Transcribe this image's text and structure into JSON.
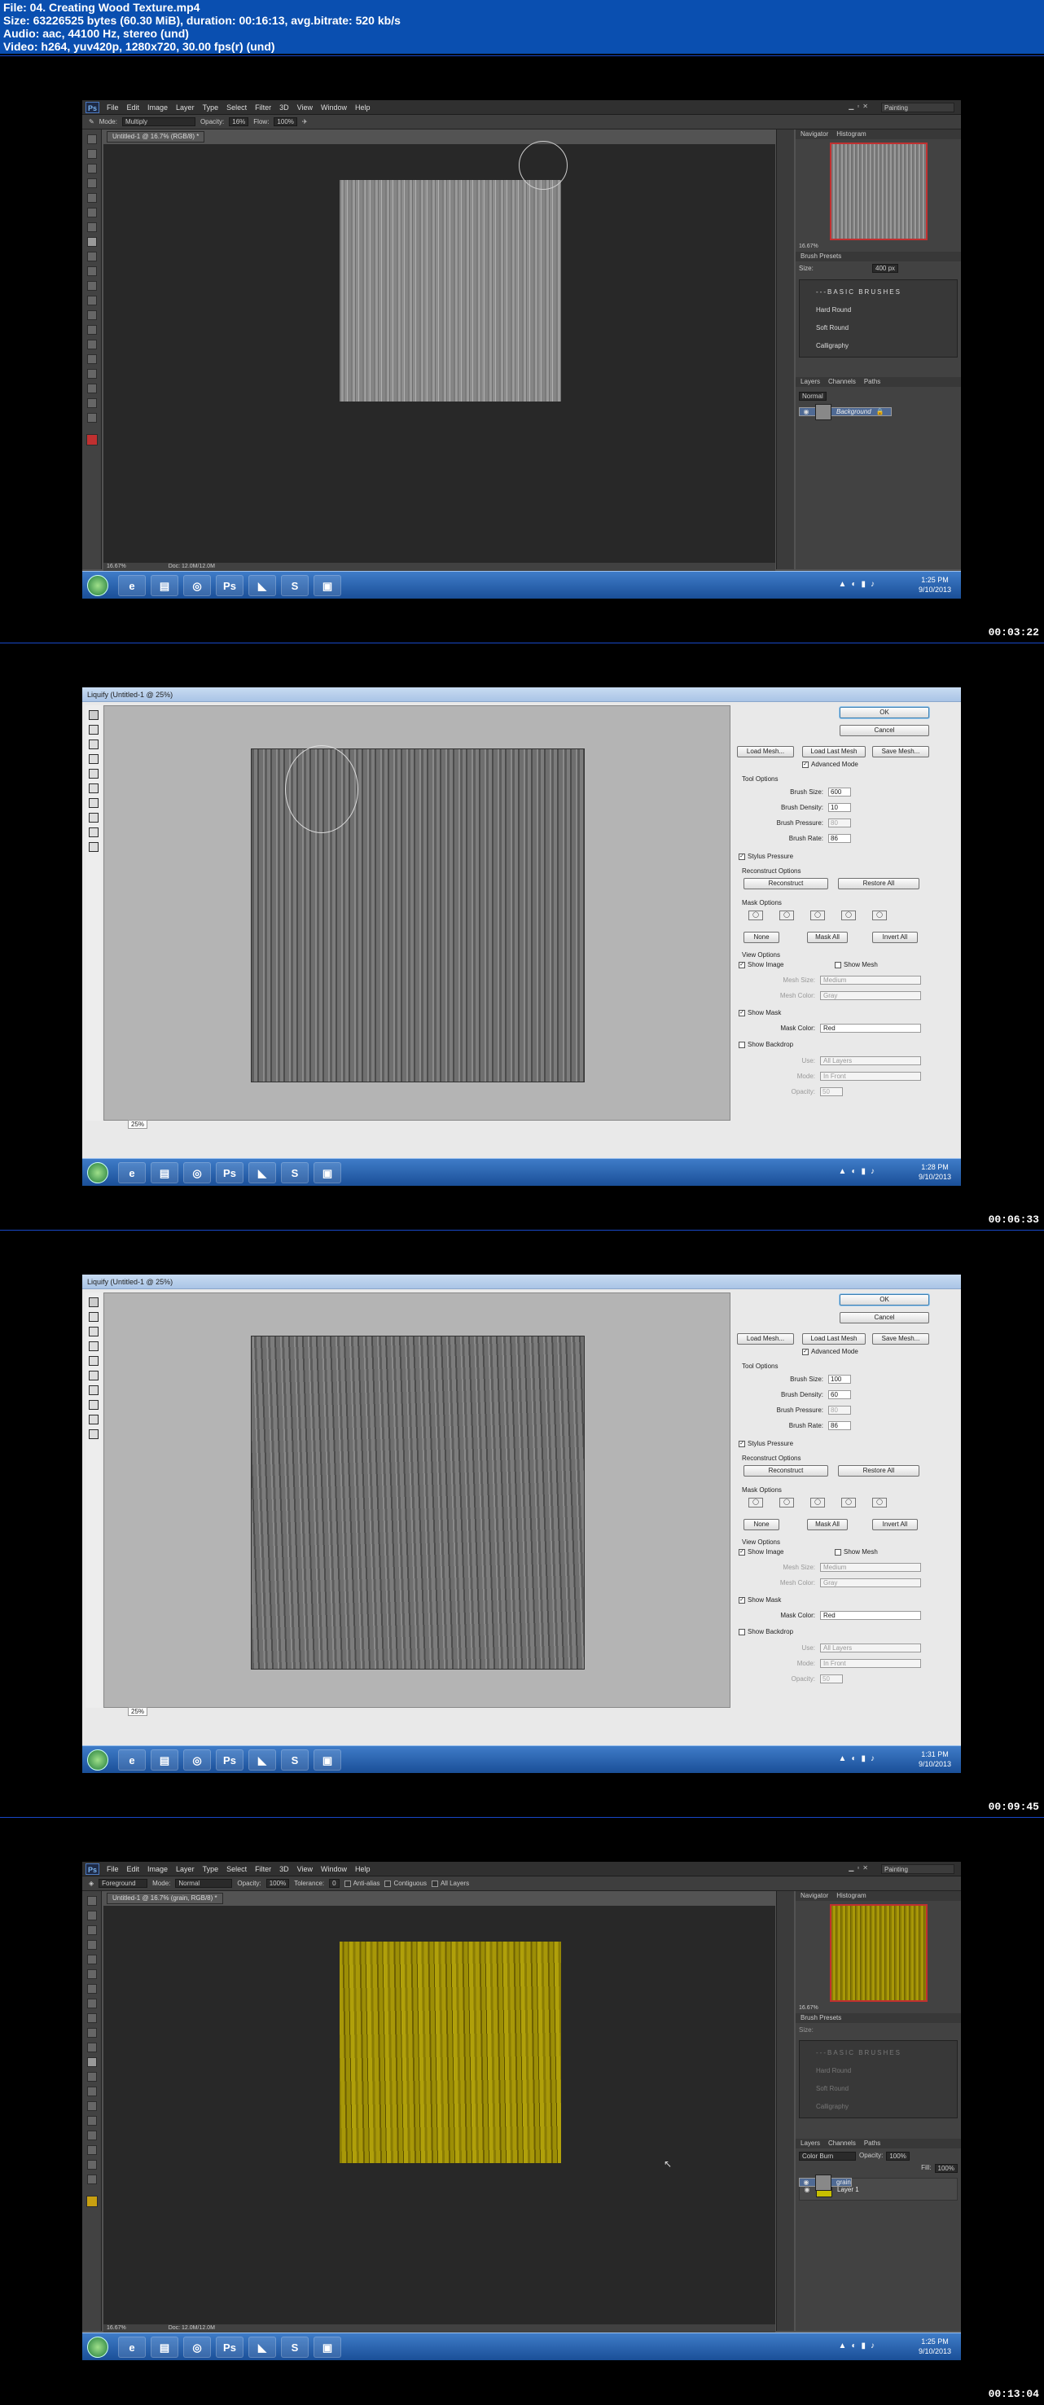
{
  "header": {
    "line1": "File: 04. Creating Wood Texture.mp4",
    "line2": "Size: 63226525 bytes (60.30 MiB), duration: 00:16:13, avg.bitrate: 520 kb/s",
    "line3": "Audio: aac, 44100 Hz, stereo (und)",
    "line4": "Video: h264, yuv420p, 1280x720, 30.00 fps(r) (und)"
  },
  "menu": [
    "File",
    "Edit",
    "Image",
    "Layer",
    "Type",
    "Select",
    "Filter",
    "3D",
    "View",
    "Window",
    "Help"
  ],
  "workspace": "Painting",
  "frames": [
    {
      "timestamp": "00:03:22",
      "clock_time": "1:25 PM",
      "clock_date": "9/10/2013",
      "doc_tab": "Untitled-1 @ 16.7% (RGB/8) *",
      "zoom": "16.67%",
      "doc_size": "Doc: 12.0M/12.0M",
      "opt_mode_label": "Mode:",
      "opt_mode": "Multiply",
      "opt_opacity_label": "Opacity:",
      "opt_opacity": "16%",
      "opt_flow_label": "Flow:",
      "opt_flow": "100%",
      "nav_tab": "Navigator",
      "hist_tab": "Histogram",
      "brush_tab": "Brush Presets",
      "size_label": "Size:",
      "size_value": "400 px",
      "brush_header": "---BASIC BRUSHES",
      "brushes": [
        "Hard Round",
        "Soft Round",
        "Calligraphy"
      ],
      "layer_tabs": [
        "Layers",
        "Channels",
        "Paths"
      ],
      "blend": "Normal",
      "layers": [
        "Background"
      ]
    },
    {
      "timestamp": "00:06:33",
      "clock_time": "1:28 PM",
      "clock_date": "9/10/2013",
      "title": "Liquify (Untitled-1 @ 25%)",
      "zoom": "25%",
      "brush_size": "600",
      "brush_density": "10",
      "brush_pressure": "80",
      "brush_rate": "86"
    },
    {
      "timestamp": "00:09:45",
      "clock_time": "1:31 PM",
      "clock_date": "9/10/2013",
      "title": "Liquify (Untitled-1 @ 25%)",
      "zoom": "25%",
      "brush_size": "100",
      "brush_density": "60",
      "brush_pressure": "80",
      "brush_rate": "86"
    },
    {
      "timestamp": "00:13:04",
      "clock_time": "1:25 PM",
      "clock_date": "9/10/2013",
      "doc_tab": "Untitled-1 @ 16.7% (grain, RGB/8) *",
      "zoom": "16.67%",
      "doc_size": "Doc: 12.0M/12.0M",
      "opt_mode_label": "Mode:",
      "opt_mode": "Normal",
      "opt_opacity_label": "Opacity:",
      "opt_opacity": "100%",
      "opt_tolerance_label": "Tolerance:",
      "opt_tolerance": "0",
      "opt_aa": "Anti-alias",
      "opt_contig": "Contiguous",
      "opt_all": "All Layers",
      "tool_preset": "Foreground",
      "nav_tab": "Navigator",
      "hist_tab": "Histogram",
      "brush_tab": "Brush Presets",
      "size_label": "Size:",
      "size_value": "",
      "brush_header": "---BASIC BRUSHES",
      "brushes": [
        "Hard Round",
        "Soft Round",
        "Calligraphy"
      ],
      "layer_tabs": [
        "Layers",
        "Channels",
        "Paths"
      ],
      "blend": "Color Burn",
      "opacity_label": "Opacity:",
      "opacity_value": "100%",
      "fill_label": "Fill:",
      "fill_value": "100%",
      "layers": [
        "grain",
        "Layer 1"
      ]
    }
  ],
  "liquify": {
    "ok": "OK",
    "cancel": "Cancel",
    "load_mesh": "Load Mesh...",
    "load_last": "Load Last Mesh",
    "save_mesh": "Save Mesh...",
    "advanced": "Advanced Mode",
    "tool_options": "Tool Options",
    "brush_size_label": "Brush Size:",
    "brush_density_label": "Brush Density:",
    "brush_pressure_label": "Brush Pressure:",
    "brush_rate_label": "Brush Rate:",
    "stylus": "Stylus Pressure",
    "reconstruct_options": "Reconstruct Options",
    "reconstruct": "Reconstruct",
    "restore_all": "Restore All",
    "mask_options": "Mask Options",
    "none": "None",
    "mask_all": "Mask All",
    "invert_all": "Invert All",
    "view_options": "View Options",
    "show_image": "Show Image",
    "show_mesh": "Show Mesh",
    "mesh_size_label": "Mesh Size:",
    "mesh_size": "Medium",
    "mesh_color_label": "Mesh Color:",
    "mesh_color": "Gray",
    "show_mask": "Show Mask",
    "mask_color_label": "Mask Color:",
    "mask_color": "Red",
    "show_backdrop": "Show Backdrop",
    "use_label": "Use:",
    "use": "All Layers",
    "mode_label": "Mode:",
    "mode": "In Front",
    "opacity_label": "Opacity:",
    "opacity": "50"
  },
  "colors": {
    "wood_yellow": "#a89808",
    "accent_red": "#c03030",
    "titlebar": "#1060d0"
  }
}
